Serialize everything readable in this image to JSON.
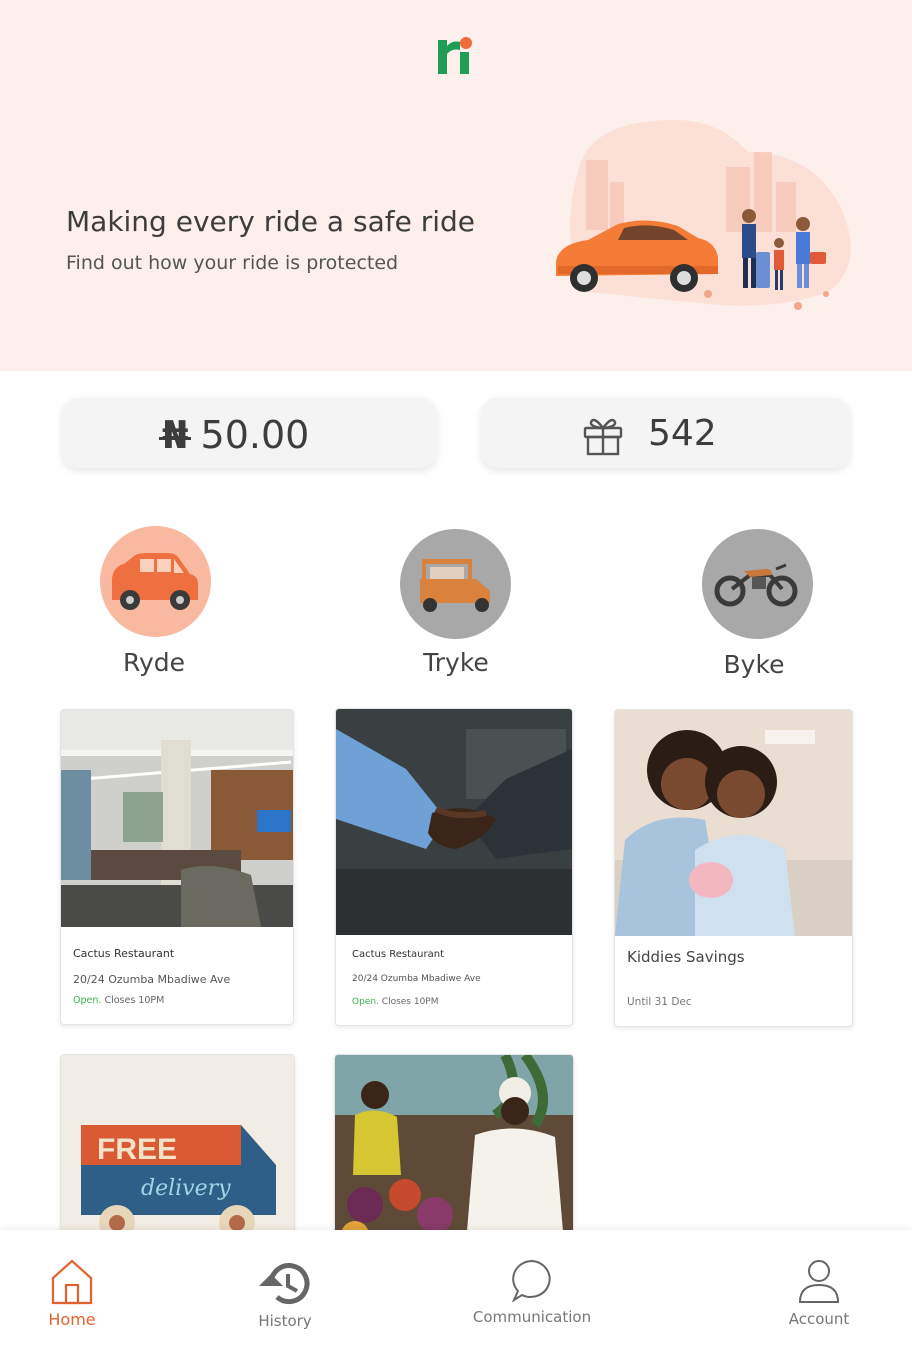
{
  "hero": {
    "title": "Making every ride a safe ride",
    "subtitle": "Find out how your ride is protected"
  },
  "wallet": {
    "currency_symbol": "₦",
    "amount": "50.00"
  },
  "points": {
    "icon": "gift-icon",
    "value": "542"
  },
  "ride_types": [
    {
      "label": "Ryde",
      "icon": "car-icon",
      "color": "#f8b9a0"
    },
    {
      "label": "Tryke",
      "icon": "tricycle-icon",
      "color": "#a8a8a8"
    },
    {
      "label": "Byke",
      "icon": "motorbike-icon",
      "color": "#a8a8a8"
    }
  ],
  "offers": [
    {
      "title": "Cactus Restaurant",
      "address": "20/24 Ozumba Mbadiwe Ave",
      "status": "Open.",
      "hours": "Closes 10PM"
    },
    {
      "title": "Cactus Restaurant",
      "address": "20/24 Ozumba Mbadiwe Ave",
      "status": "Open.",
      "hours": "Closes 10PM"
    },
    {
      "title": "Kiddies Savings",
      "until": "Until 31 Dec"
    }
  ],
  "bottom_nav": [
    {
      "label": "Home",
      "icon": "home-icon",
      "active": true
    },
    {
      "label": "History",
      "icon": "history-icon"
    },
    {
      "label": "Communication",
      "icon": "chat-icon"
    },
    {
      "label": "Account",
      "icon": "user-icon"
    }
  ],
  "colors": {
    "accent": "#e3612f",
    "hero_bg": "#fdf0ec",
    "open_green": "#3bb54a",
    "logo_green": "#1f9d55"
  }
}
